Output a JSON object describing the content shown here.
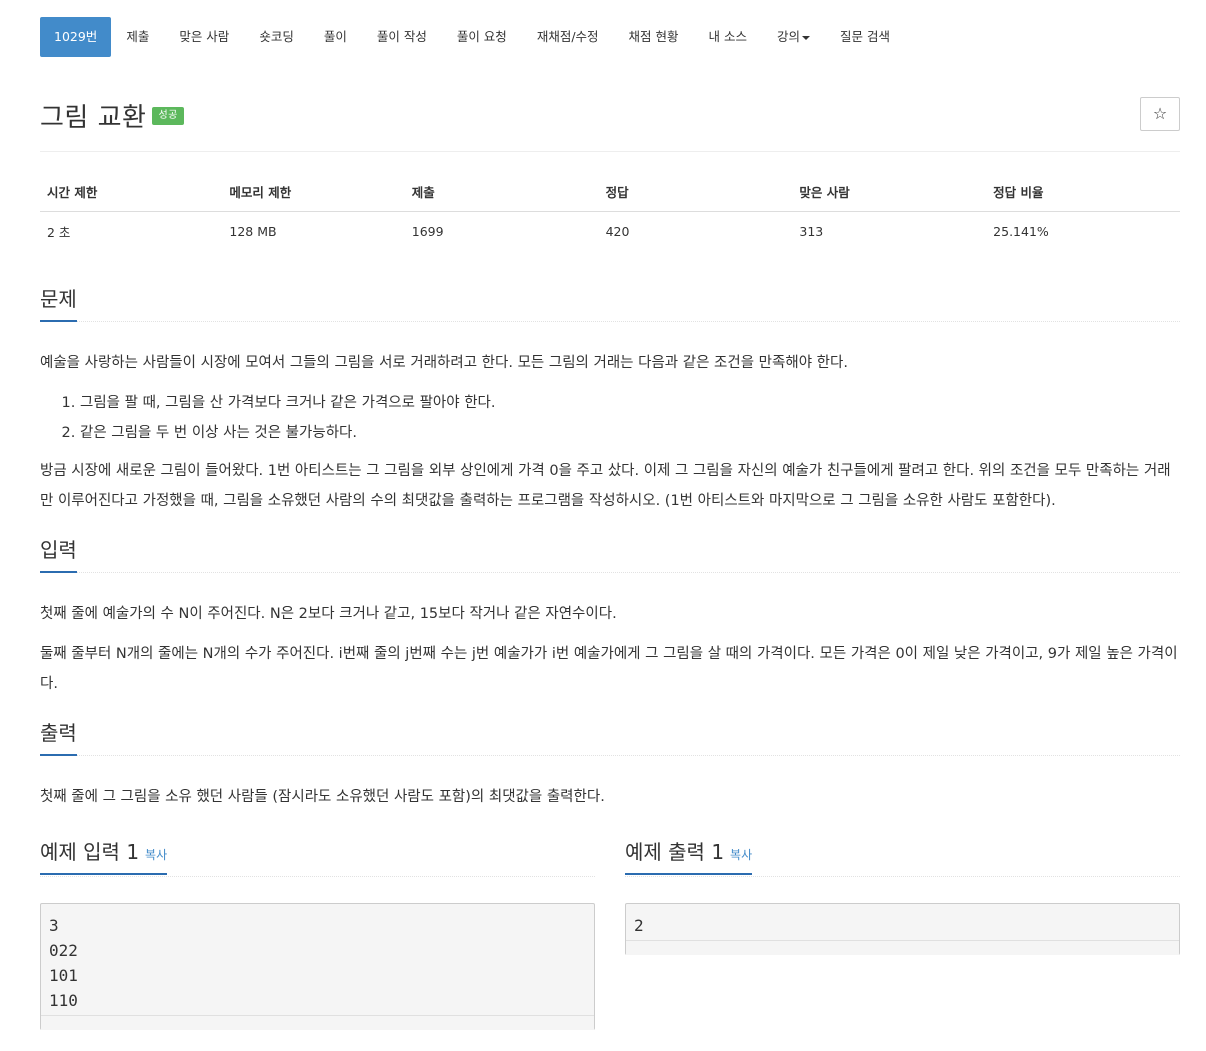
{
  "nav": {
    "items": [
      {
        "label": "1029번",
        "active": true
      },
      {
        "label": "제출"
      },
      {
        "label": "맞은 사람"
      },
      {
        "label": "숏코딩"
      },
      {
        "label": "풀이"
      },
      {
        "label": "풀이 작성"
      },
      {
        "label": "풀이 요청"
      },
      {
        "label": "재채점/수정"
      },
      {
        "label": "채점 현황"
      },
      {
        "label": "내 소스"
      },
      {
        "label": "강의",
        "dropdown": true
      },
      {
        "label": "질문 검색"
      }
    ]
  },
  "problem": {
    "title": "그림 교환",
    "status_badge": "성공",
    "star_icon": "☆"
  },
  "stats": {
    "headers": [
      "시간 제한",
      "메모리 제한",
      "제출",
      "정답",
      "맞은 사람",
      "정답 비율"
    ],
    "values": [
      "2 초",
      "128 MB",
      "1699",
      "420",
      "313",
      "25.141%"
    ]
  },
  "sections": {
    "description": {
      "heading": "문제",
      "intro": "예술을 사랑하는 사람들이 시장에 모여서 그들의 그림을 서로 거래하려고 한다. 모든 그림의 거래는 다음과 같은 조건을 만족해야 한다.",
      "conditions": [
        "그림을 팔 때, 그림을 산 가격보다 크거나 같은 가격으로 팔아야 한다.",
        "같은 그림을 두 번 이상 사는 것은 불가능하다."
      ],
      "body": "방금 시장에 새로운 그림이 들어왔다. 1번 아티스트는 그 그림을 외부 상인에게 가격 0을 주고 샀다. 이제 그 그림을 자신의 예술가 친구들에게 팔려고 한다. 위의 조건을 모두 만족하는 거래만 이루어진다고 가정했을 때, 그림을 소유했던 사람의 수의 최댓값을 출력하는 프로그램을 작성하시오. (1번 아티스트와 마지막으로 그 그림을 소유한 사람도 포함한다)."
    },
    "input": {
      "heading": "입력",
      "line1": "첫째 줄에 예술가의 수 N이 주어진다. N은 2보다 크거나 같고, 15보다 작거나 같은 자연수이다.",
      "line2": "둘째 줄부터 N개의 줄에는 N개의 수가 주어진다. i번째 줄의 j번째 수는 j번 예술가가 i번 예술가에게 그 그림을 살 때의 가격이다. 모든 가격은 0이 제일 낮은 가격이고, 9가 제일 높은 가격이다."
    },
    "output": {
      "heading": "출력",
      "line1": "첫째 줄에 그 그림을 소유 했던 사람들 (잠시라도 소유했던 사람도 포함)의 최댓값을 출력한다."
    }
  },
  "examples": {
    "input": {
      "heading": "예제 입력 1",
      "copy_label": "복사",
      "content": "3\n022\n101\n110"
    },
    "output": {
      "heading": "예제 출력 1",
      "copy_label": "복사",
      "content": "2"
    }
  },
  "colors": {
    "accent": "#428bca",
    "success": "#5cb85c",
    "heading_underline": "#2b6cb0"
  }
}
